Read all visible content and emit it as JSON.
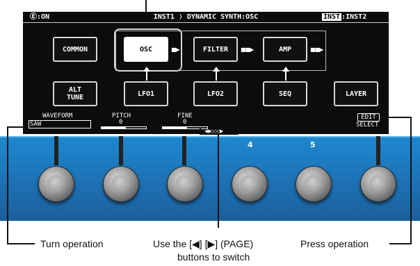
{
  "status_bar": {
    "power": "Ⓔ:ON",
    "breadcrumb": "INST1 ❭ DYNAMIC SYNTH:OSC",
    "inst_selected": "INST",
    "inst_other": ":INST2"
  },
  "blocks": {
    "common": "COMMON",
    "osc": "OSC",
    "filter": "FILTER",
    "amp": "AMP",
    "alt_tune_line1": "ALT",
    "alt_tune_line2": "TUNE",
    "lfo1": "LFO1",
    "lfo2": "LFO2",
    "seq": "SEQ",
    "layer": "LAYER"
  },
  "params": {
    "waveform_label": "WAVEFORM",
    "waveform_value": "SAW",
    "pitch_label": "PITCH",
    "pitch_value": "0",
    "fine_label": "FINE",
    "fine_value": "0",
    "edit_label": "EDIT",
    "select_label": "SELECT",
    "page_indicator": "◀◆◇◇◇▶"
  },
  "knob_numbers": [
    "4",
    "5"
  ],
  "captions": {
    "turn": "Turn operation",
    "page_line1": "Use the [◀] [▶] (PAGE)",
    "page_line2": "buttons to switch",
    "press": "Press operation"
  },
  "colors": {
    "panel_blue": "#1e7cc4",
    "lcd_background": "#0c0c0c"
  }
}
